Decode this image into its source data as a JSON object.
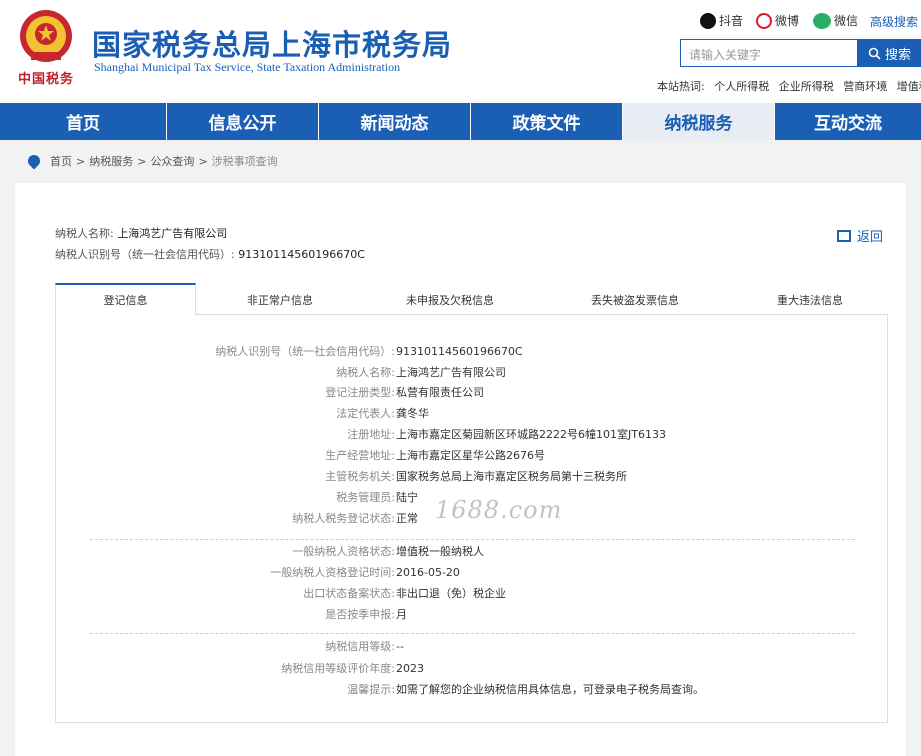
{
  "header": {
    "logo_text": "中国税务",
    "title": "国家税务总局上海市税务局",
    "subtitle": "Shanghai Municipal Tax Service, State Taxation Administration",
    "social": [
      {
        "label": "抖音",
        "icon": "douyin-icon",
        "color": "#111111"
      },
      {
        "label": "微博",
        "icon": "weibo-icon",
        "color": "#e6162d"
      },
      {
        "label": "微信",
        "icon": "wechat-icon",
        "color": "#2aae67"
      }
    ],
    "advanced_search": "高级搜索",
    "search": {
      "placeholder": "请输入关键字",
      "button": "搜索"
    },
    "hot": {
      "label": "本站热词:",
      "items": [
        "个人所得税",
        "企业所得税",
        "营商环境",
        "增值税"
      ]
    }
  },
  "nav": {
    "items": [
      "首页",
      "信息公开",
      "新闻动态",
      "政策文件",
      "纳税服务",
      "互动交流"
    ],
    "active_index": 4
  },
  "breadcrumb": [
    "首页",
    "纳税服务",
    "公众查询",
    "涉税事项查询"
  ],
  "taxpayer": {
    "name_label": "纳税人名称:",
    "name": "上海鸿艺广告有限公司",
    "id_label": "纳税人识别号（统一社会信用代码）:",
    "id": "91310114560196670C"
  },
  "back_label": "返回",
  "tabs": [
    "登记信息",
    "非正常户信息",
    "未申报及欠税信息",
    "丢失被盗发票信息",
    "重大违法信息"
  ],
  "active_tab": 0,
  "details": {
    "group1": [
      {
        "label": "纳税人识别号（统一社会信用代码）:",
        "value": "91310114560196670C"
      },
      {
        "label": "纳税人名称:",
        "value": "上海鸿艺广告有限公司"
      },
      {
        "label": "登记注册类型:",
        "value": "私营有限责任公司"
      },
      {
        "label": "法定代表人:",
        "value": "龚冬华"
      },
      {
        "label": "注册地址:",
        "value": "上海市嘉定区菊园新区环城路2222号6幢101室JT6133"
      },
      {
        "label": "生产经营地址:",
        "value": "上海市嘉定区星华公路2676号"
      },
      {
        "label": "主管税务机关:",
        "value": "国家税务总局上海市嘉定区税务局第十三税务所"
      },
      {
        "label": "税务管理员:",
        "value": "陆宁"
      },
      {
        "label": "纳税人税务登记状态:",
        "value": "正常"
      }
    ],
    "group2": [
      {
        "label": "一般纳税人资格状态:",
        "value": "增值税一般纳税人"
      },
      {
        "label": "一般纳税人资格登记时间:",
        "value": "2016-05-20"
      },
      {
        "label": "出口状态备案状态:",
        "value": "非出口退（免）税企业"
      },
      {
        "label": "是否按季申报:",
        "value": "月"
      }
    ],
    "group3": [
      {
        "label": "纳税信用等级:",
        "value": "--"
      },
      {
        "label": "纳税信用等级评价年度:",
        "value": "2023"
      },
      {
        "label": "温馨提示:",
        "value": "如需了解您的企业纳税信用具体信息，可登录电子税务局查询。"
      }
    ]
  },
  "watermark": "1688.com"
}
